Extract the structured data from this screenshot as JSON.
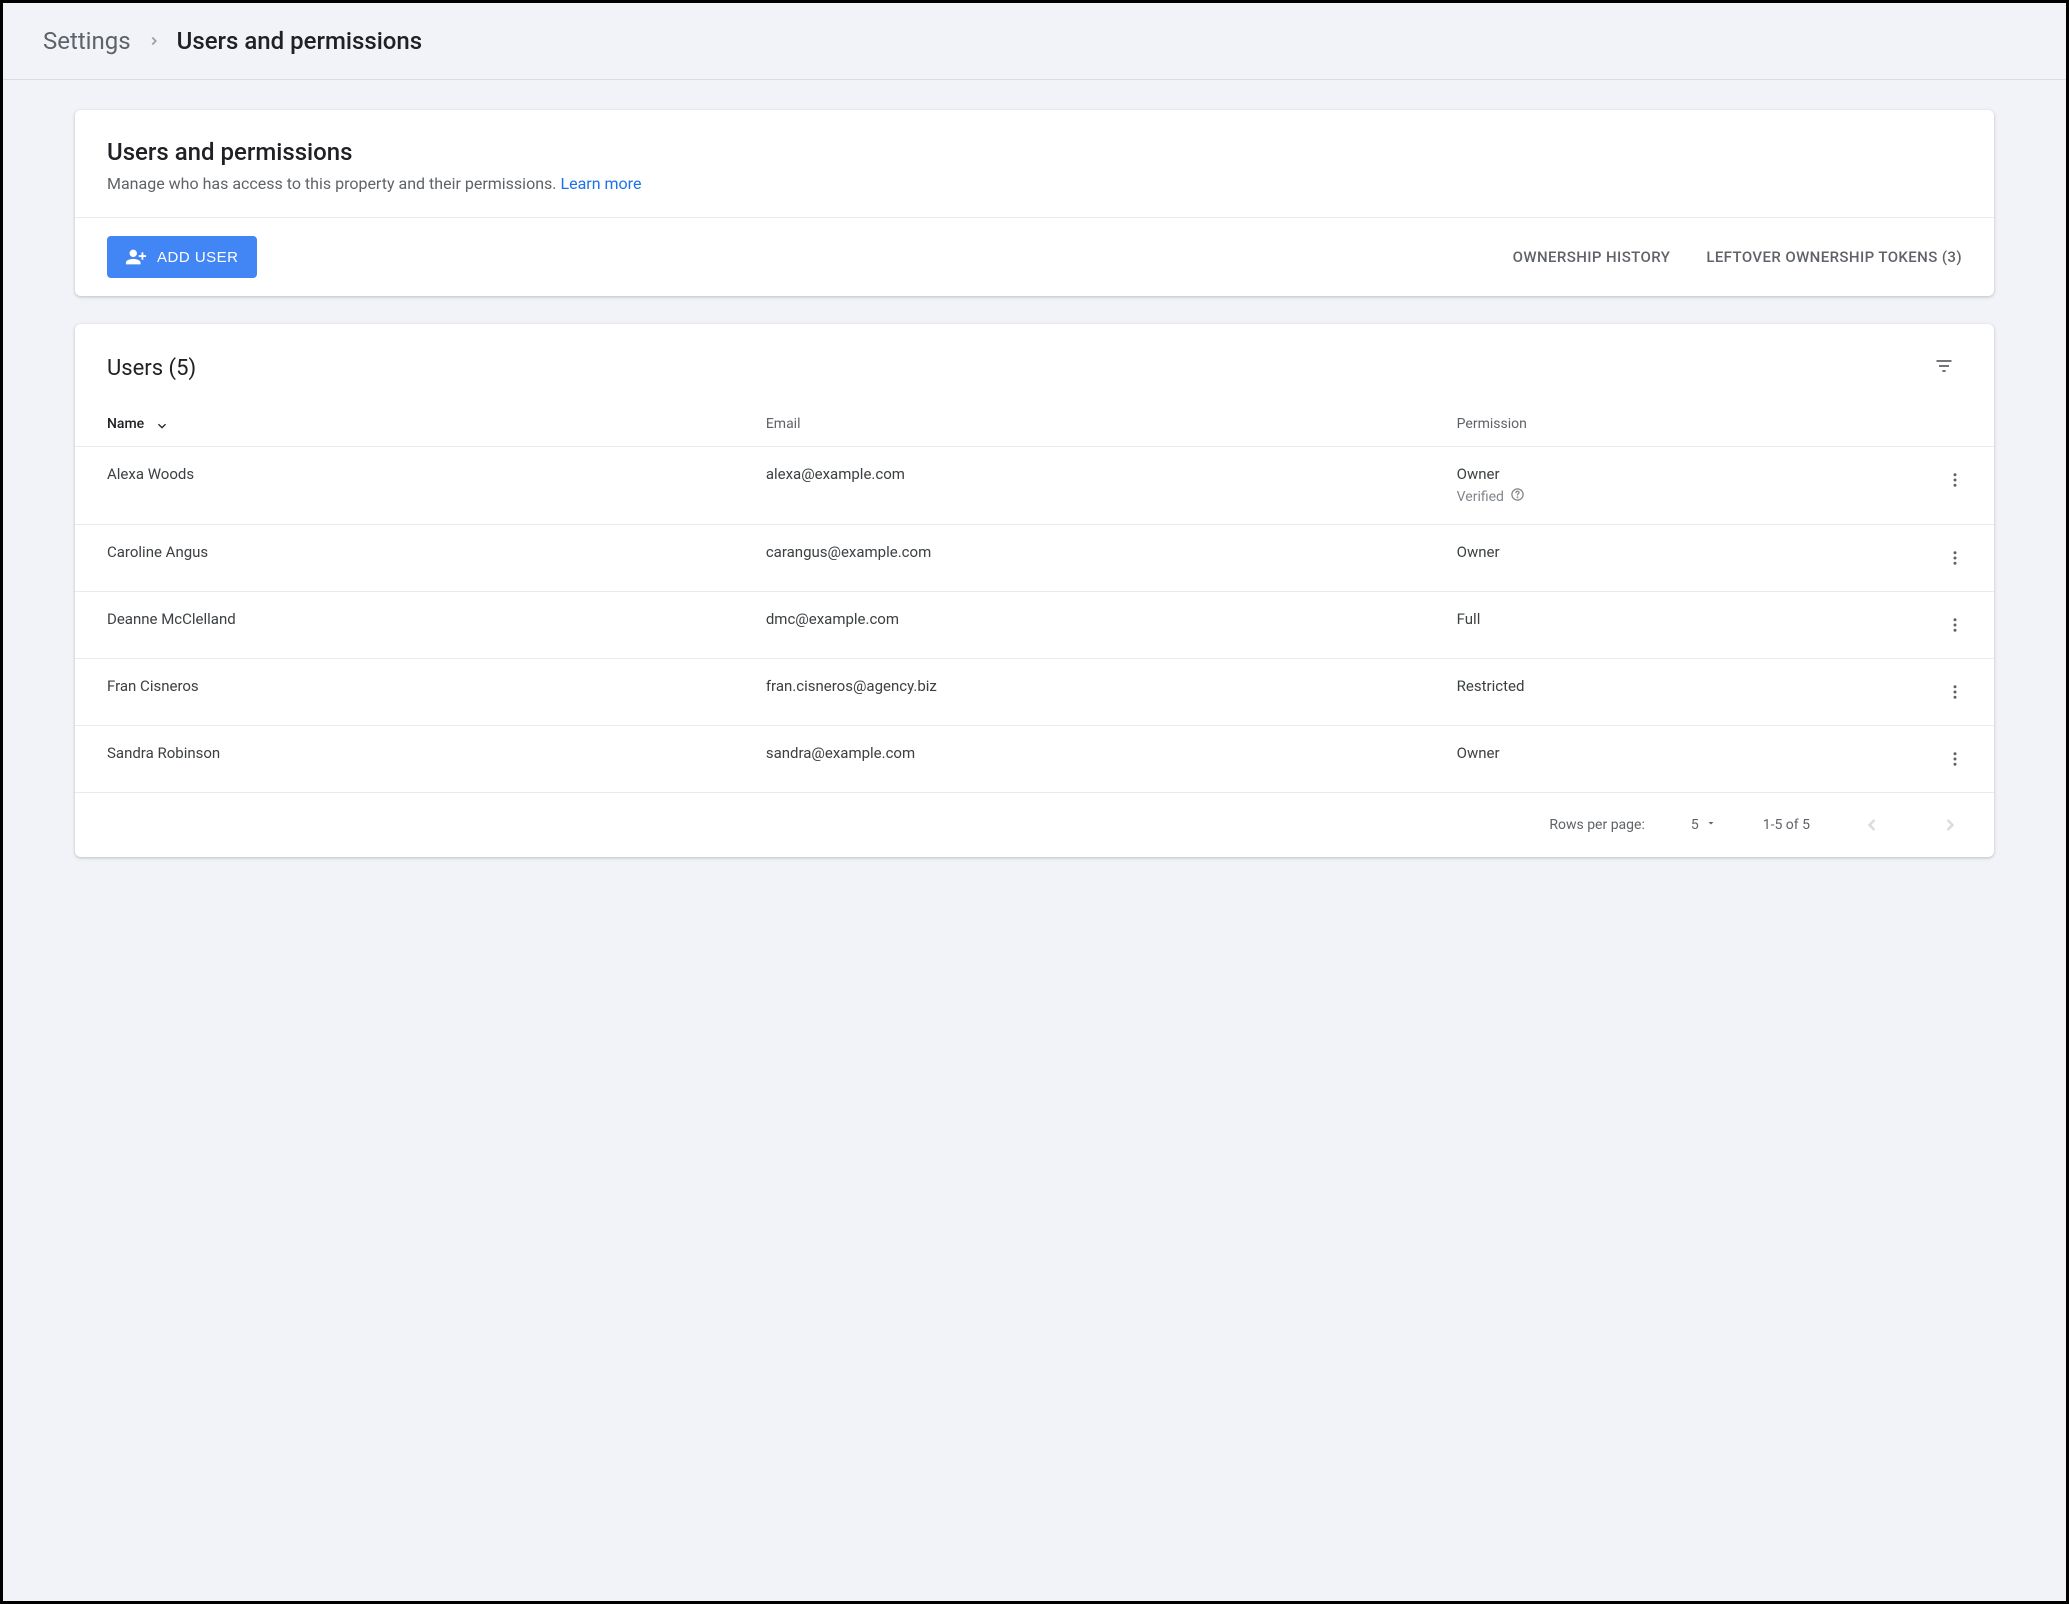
{
  "breadcrumb": {
    "parent": "Settings",
    "current": "Users and permissions"
  },
  "headerCard": {
    "title": "Users and permissions",
    "subtitle": "Manage who has access to this property and their permissions. ",
    "learnMore": "Learn more",
    "addUser": "ADD USER",
    "ownershipHistory": "OWNERSHIP HISTORY",
    "leftoverTokens": "LEFTOVER OWNERSHIP TOKENS (3)"
  },
  "usersTable": {
    "title": "Users (5)",
    "columns": {
      "name": "Name",
      "email": "Email",
      "permission": "Permission"
    },
    "verifiedLabel": "Verified",
    "rows": [
      {
        "name": "Alexa Woods",
        "email": "alexa@example.com",
        "permission": "Owner",
        "verified": true
      },
      {
        "name": "Caroline Angus",
        "email": "carangus@example.com",
        "permission": "Owner",
        "verified": false
      },
      {
        "name": "Deanne McClelland",
        "email": "dmc@example.com",
        "permission": "Full",
        "verified": false
      },
      {
        "name": "Fran Cisneros",
        "email": "fran.cisneros@agency.biz",
        "permission": "Restricted",
        "verified": false
      },
      {
        "name": "Sandra Robinson",
        "email": "sandra@example.com",
        "permission": "Owner",
        "verified": false
      }
    ],
    "footer": {
      "rowsPerPageLabel": "Rows per page:",
      "rowsPerPageValue": "5",
      "rangeLabel": "1-5 of 5"
    }
  }
}
